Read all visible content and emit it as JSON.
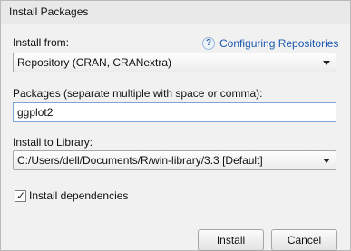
{
  "window": {
    "title": "Install Packages"
  },
  "install_from": {
    "label": "Install from:",
    "help_icon": "?",
    "link_text": "Configuring Repositories",
    "selected": "Repository (CRAN, CRANextra)"
  },
  "packages": {
    "label": "Packages (separate multiple with space or comma):",
    "value": "ggplot2"
  },
  "library": {
    "label": "Install to Library:",
    "selected": "C:/Users/dell/Documents/R/win-library/3.3 [Default]"
  },
  "dependencies": {
    "label": "Install dependencies",
    "checked": true,
    "check_mark": "✓"
  },
  "buttons": {
    "install": "Install",
    "cancel": "Cancel"
  }
}
